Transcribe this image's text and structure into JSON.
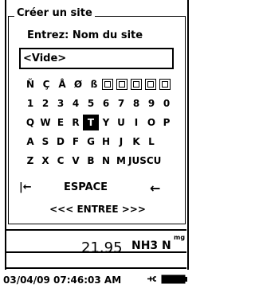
{
  "dialog": {
    "title": "Créer un site",
    "prompt": "Entrez: Nom du site",
    "input_value": "<Vide>"
  },
  "keyboard": {
    "row0": [
      "Ñ",
      "Ç",
      "Å",
      "Ø",
      "ß"
    ],
    "row0_symbols": [
      "sym1",
      "sym2",
      "sym3",
      "sym4",
      "sym5"
    ],
    "row1": [
      "1",
      "2",
      "3",
      "4",
      "5",
      "6",
      "7",
      "8",
      "9",
      "0"
    ],
    "row2": [
      "Q",
      "W",
      "E",
      "R",
      "T",
      "Y",
      "U",
      "I",
      "O",
      "P"
    ],
    "row3": [
      "A",
      "S",
      "D",
      "F",
      "G",
      "H",
      "J",
      "K",
      "L"
    ],
    "row4": [
      "Z",
      "X",
      "C",
      "V",
      "B",
      "N",
      "M",
      "JUSCU"
    ],
    "selected_key": "T",
    "backspace_symbol": "|←",
    "space_label": "ESPACE",
    "left_arrow": "←",
    "enter_label": "<<< ENTREE >>>"
  },
  "readout": {
    "value": "21.95",
    "unit": "NH3 N",
    "unit_sub": "mg"
  },
  "status": {
    "datetime": "03/04/09 07:46:03 AM"
  }
}
